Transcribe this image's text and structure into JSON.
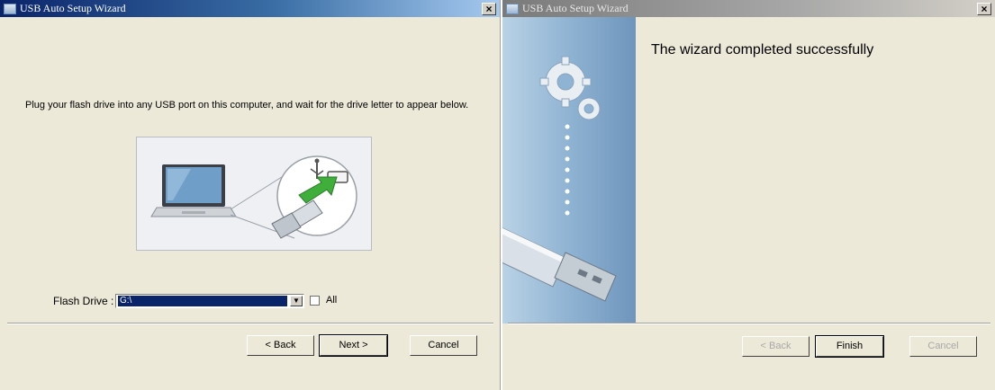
{
  "left_window": {
    "title": "USB Auto Setup Wizard",
    "close_label": "×",
    "instruction": "Plug your flash drive into any USB port on this computer, and wait for the drive letter to appear below.",
    "drive_label": "Flash Drive :",
    "drive_value": "G:\\",
    "all_label": "All",
    "all_checked": false,
    "buttons": {
      "back": "< Back",
      "next": "Next >",
      "cancel": "Cancel"
    }
  },
  "right_window": {
    "title": "USB Auto Setup Wizard",
    "close_label": "×",
    "heading": "The wizard completed successfully",
    "buttons": {
      "back": "< Back",
      "finish": "Finish",
      "cancel": "Cancel"
    }
  },
  "icons": [
    "app-icon",
    "close-icon",
    "laptop-icon",
    "usb-plug-icon",
    "usb-symbol-icon",
    "insert-arrow-icon",
    "gears-icon",
    "usb-flash-drive-icon",
    "dropdown-arrow-icon"
  ],
  "colors": {
    "active_titlebar": "#0a246a",
    "inactive_titlebar": "#7a7a7a",
    "dialog_bg": "#ece9d8",
    "selection": "#0a246a",
    "insert_arrow": "#3fae3a"
  }
}
